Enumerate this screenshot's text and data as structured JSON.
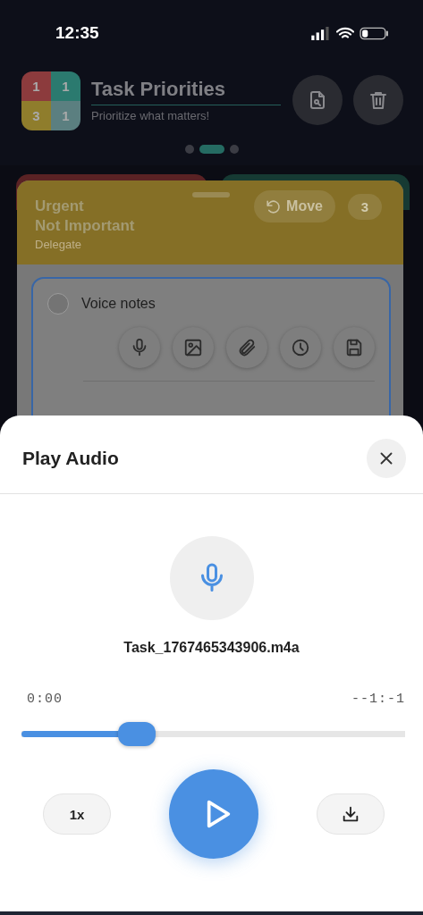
{
  "status_bar": {
    "time": "12:35"
  },
  "header": {
    "title": "Task Priorities",
    "subtitle": "Prioritize what matters!",
    "logo_cells": [
      {
        "value": "1",
        "color": "#8c3b3d"
      },
      {
        "value": "1",
        "color": "#2b7a6f"
      },
      {
        "value": "3",
        "color": "#8f7d2c"
      },
      {
        "value": "1",
        "color": "#5b7f80"
      }
    ]
  },
  "page_dots": [
    {
      "selected": false
    },
    {
      "selected": true
    },
    {
      "selected": false
    }
  ],
  "quadrant": {
    "title_lines": [
      "Urgent",
      "Not Important"
    ],
    "subtitle": "Delegate",
    "move_label": "Move",
    "count": "3"
  },
  "task": {
    "text": "Voice notes",
    "checked": false
  },
  "sheet": {
    "title": "Play Audio",
    "file_name": "Task_1767465343906.m4a",
    "elapsed": "0:00",
    "remaining": "--1:-1",
    "progress": {
      "level": 0.3
    },
    "speed": "1x",
    "playing": false
  }
}
